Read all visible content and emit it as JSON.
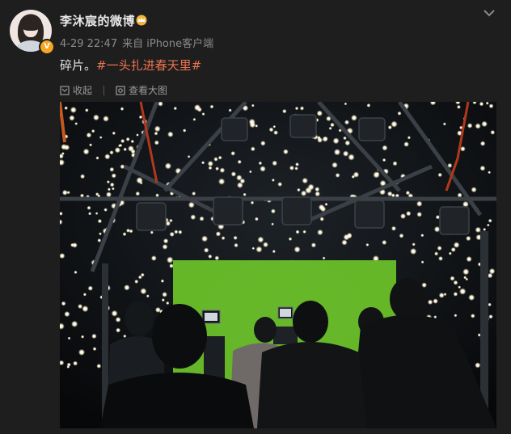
{
  "post": {
    "username": "李沐宸的微博",
    "time": "4-29 22:47",
    "source": "来自 iPhone客户端",
    "text_plain": "碎片。",
    "hashtag": "#一头扎进春天里#"
  },
  "actions": {
    "collect": "收起",
    "view_large": "查看大图"
  },
  "icons": {
    "verified": "verified-badge-icon",
    "crown": "crown-icon",
    "more": "chevron-down-icon"
  },
  "colors": {
    "background": "#1e1e1e",
    "hashtag": "#eb7350",
    "verified": "#f6a623",
    "green_screen": "#6dc52a"
  }
}
